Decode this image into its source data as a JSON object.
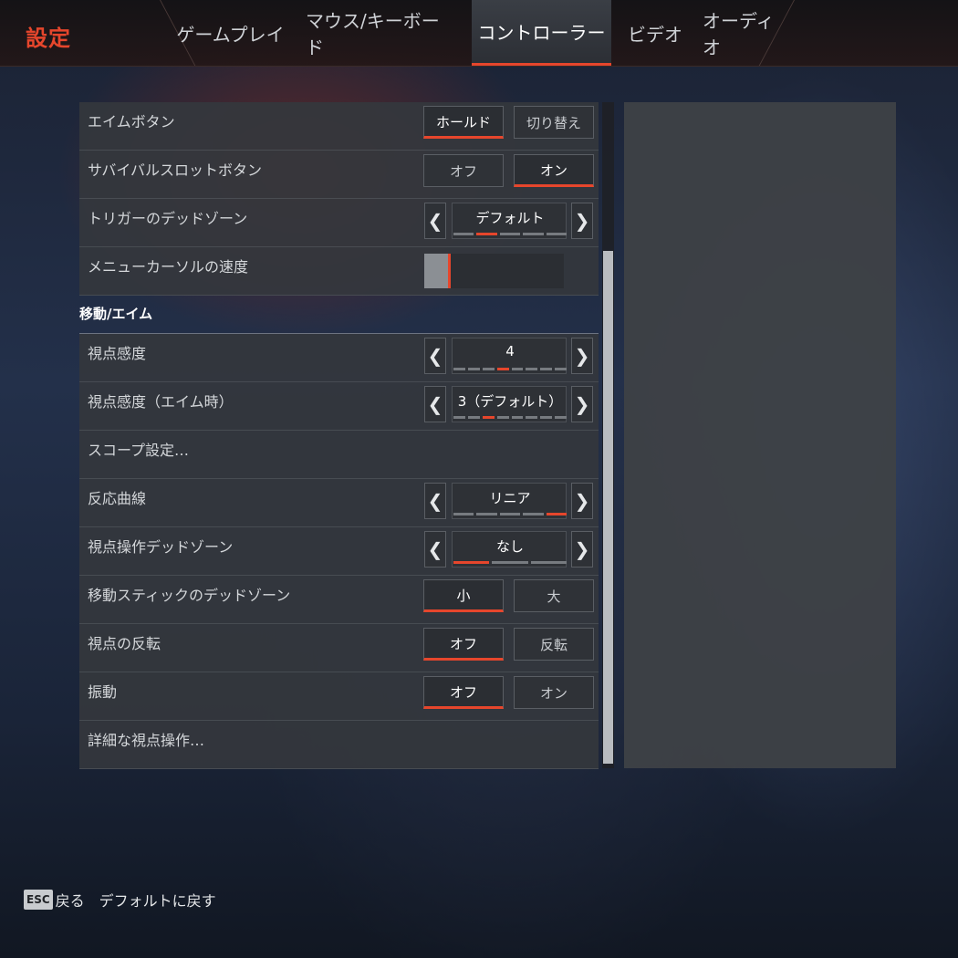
{
  "header": {
    "title": "設定",
    "tabs": [
      {
        "label": "ゲームプレイ"
      },
      {
        "label": "マウス/キーボード"
      },
      {
        "label": "コントローラー"
      },
      {
        "label": "ビデオ"
      },
      {
        "label": "オーディオ"
      }
    ],
    "active_tab": "コントローラー"
  },
  "settings": {
    "aim_button": {
      "label": "エイムボタン",
      "options": [
        "ホールド",
        "切り替え"
      ],
      "selected": "ホールド"
    },
    "survival_slot": {
      "label": "サバイバルスロットボタン",
      "options": [
        "オフ",
        "オン"
      ],
      "selected": "オン"
    },
    "trigger_deadzone": {
      "label": "トリガーのデッドゾーン",
      "value": "デフォルト",
      "segment_count": 5,
      "selected_index": 1
    },
    "menu_cursor_speed": {
      "label": "メニューカーソルの速度",
      "level": 0.17
    },
    "section_move_aim": "移動/エイム",
    "look_sensitivity": {
      "label": "視点感度",
      "value": "4",
      "segment_count": 8,
      "selected_index": 3
    },
    "look_sensitivity_ads": {
      "label": "視点感度（エイム時）",
      "value": "3（デフォルト）",
      "segment_count": 8,
      "selected_index": 2
    },
    "scope_settings": {
      "label": "スコープ設定…"
    },
    "response_curve": {
      "label": "反応曲線",
      "value": "リニア",
      "segment_count": 5,
      "selected_index": 4
    },
    "look_deadzone": {
      "label": "視点操作デッドゾーン",
      "value": "なし",
      "segment_count": 3,
      "selected_index": 0
    },
    "move_stick_deadzone": {
      "label": "移動スティックのデッドゾーン",
      "options": [
        "小",
        "大"
      ],
      "selected": "小"
    },
    "invert_look": {
      "label": "視点の反転",
      "options": [
        "オフ",
        "反転"
      ],
      "selected": "オフ"
    },
    "vibration": {
      "label": "振動",
      "options": [
        "オフ",
        "オン"
      ],
      "selected": "オフ"
    },
    "advanced_look": {
      "label": "詳細な視点操作…"
    }
  },
  "scrollbar": {
    "position": 0.23
  },
  "footer": {
    "esc_key": "ESC",
    "back_label": "戻る",
    "reset_label": "デフォルトに戻す"
  },
  "icons": {
    "left_arrow": "chevron-left-icon",
    "right_arrow": "chevron-right-icon"
  },
  "colors": {
    "accent": "#e6462c",
    "row_bg": "#34373d",
    "panel_bg": "#3e4146"
  }
}
